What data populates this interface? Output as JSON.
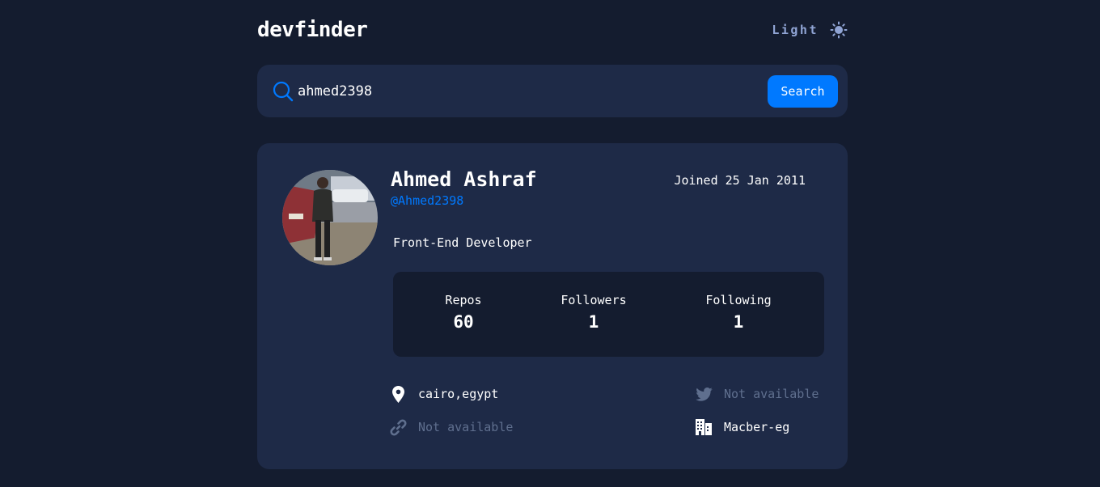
{
  "app": {
    "logo": "devfinder",
    "theme_label": "Light",
    "theme_icon": "sun-icon"
  },
  "search": {
    "value": "ahmed2398",
    "button_label": "Search",
    "icon": "search-icon"
  },
  "profile": {
    "name": "Ahmed Ashraf",
    "login": "@Ahmed2398",
    "joined": "Joined 25 Jan 2011",
    "bio": "Front-End Developer",
    "stats": {
      "repos_label": "Repos",
      "repos": "60",
      "followers_label": "Followers",
      "followers": "1",
      "following_label": "Following",
      "following": "1"
    },
    "location": "cairo,egypt",
    "blog": "Not available",
    "twitter": "Not available",
    "company": "Macber-eg"
  },
  "colors": {
    "background": "#141c2f",
    "card": "#1e2a47",
    "accent": "#0079ff",
    "muted_text": "#5f6f8e",
    "toggle_text": "#90a4d4"
  }
}
